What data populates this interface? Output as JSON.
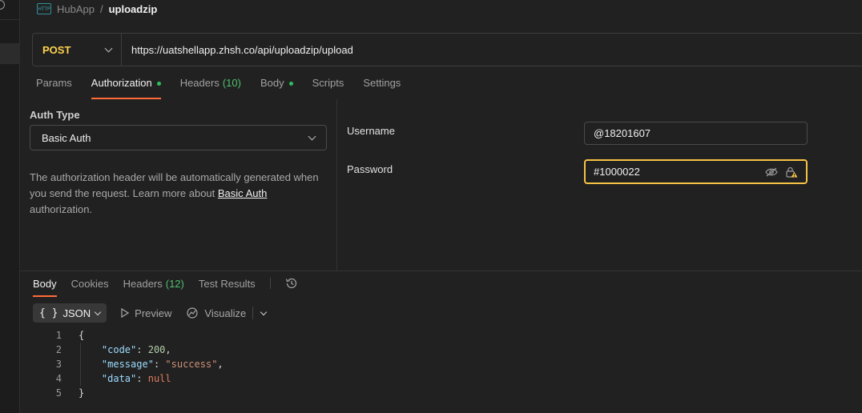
{
  "breadcrumb": {
    "app_icon": "HTTP",
    "app": "HubApp",
    "separator": "/",
    "current": "uploadzip"
  },
  "request": {
    "method": "POST",
    "url": "https://uatshellapp.zhsh.co/api/uploadzip/upload"
  },
  "request_tabs": [
    {
      "label": "Params",
      "count": "",
      "dot": false,
      "active": false
    },
    {
      "label": "Authorization",
      "count": "",
      "dot": true,
      "active": true
    },
    {
      "label": "Headers",
      "count": "(10)",
      "dot": false,
      "active": false
    },
    {
      "label": "Body",
      "count": "",
      "dot": true,
      "active": false
    },
    {
      "label": "Scripts",
      "count": "",
      "dot": false,
      "active": false
    },
    {
      "label": "Settings",
      "count": "",
      "dot": false,
      "active": false
    }
  ],
  "auth": {
    "type_label": "Auth Type",
    "type_value": "Basic Auth",
    "description_prefix": "The authorization header will be automatically generated when you send the request. Learn more about ",
    "description_link": "Basic Auth",
    "description_suffix": " authorization.",
    "username_label": "Username",
    "username_value": "@18201607",
    "password_label": "Password",
    "password_value": "#1000022"
  },
  "response_tabs": [
    {
      "label": "Body",
      "count": "",
      "active": true
    },
    {
      "label": "Cookies",
      "count": "",
      "active": false
    },
    {
      "label": "Headers",
      "count": "(12)",
      "active": false
    },
    {
      "label": "Test Results",
      "count": "",
      "active": false
    }
  ],
  "response_toolbar": {
    "format_label": "JSON",
    "preview_label": "Preview",
    "visualize_label": "Visualize"
  },
  "response_body": {
    "line_numbers": [
      "1",
      "2",
      "3",
      "4",
      "5"
    ],
    "code_key": "\"code\"",
    "code_value": "200",
    "message_key": "\"message\"",
    "message_value": "\"success\"",
    "data_key": "\"data\"",
    "data_value": "null"
  },
  "colors": {
    "method_post": "#ffd34d",
    "active_tab_underline": "#ff6c37",
    "status_dot": "#2fbf5f",
    "focused_border": "#f6c344"
  }
}
